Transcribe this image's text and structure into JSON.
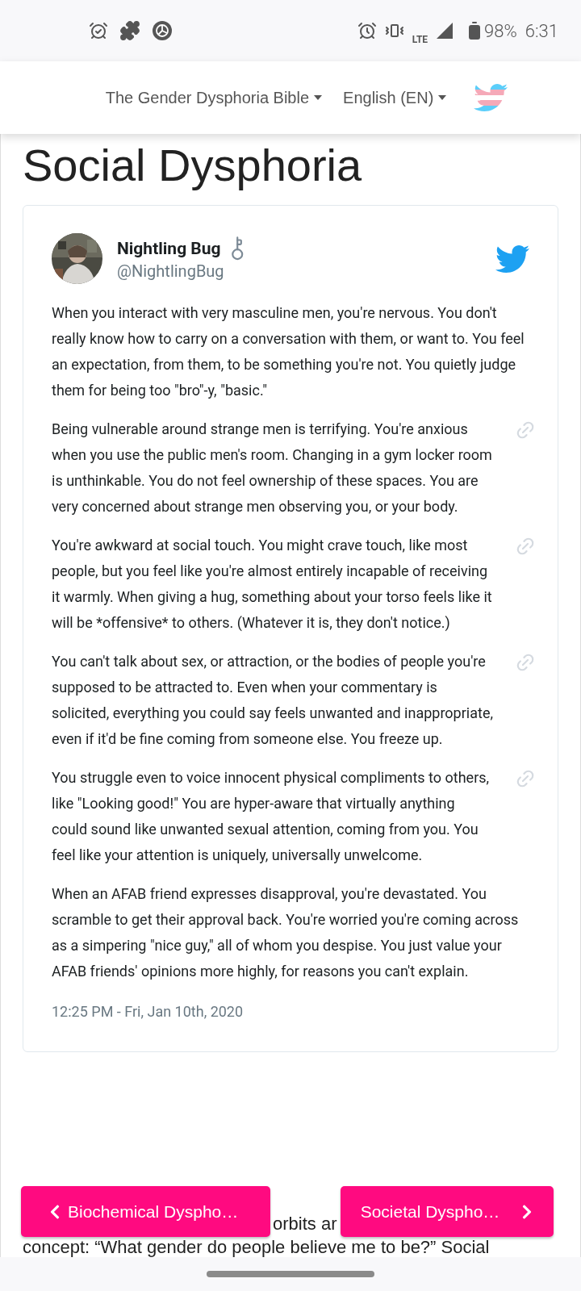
{
  "status_bar": {
    "battery": "98%",
    "time": "6:31",
    "network": "LTE"
  },
  "nav": {
    "items": [
      {
        "label": "The Gender Dysphoria Bible"
      },
      {
        "label": "English (EN)"
      }
    ]
  },
  "page_title": "Social Dysphoria",
  "tweet": {
    "name": "Nightling Bug",
    "handle": "@NightlingBug",
    "paragraphs": [
      {
        "text": "When you interact with very masculine men, you're nervous. You don't really know how to carry on a conversation with them, or want to. You feel an expectation, from them, to be something you're not. You quietly judge them for being too \"bro\"-y, \"basic.\"",
        "linked": false
      },
      {
        "text": "Being vulnerable around strange men is terrifying. You're anxious when you use the public men's room. Changing in a gym locker room is unthinkable. You do not feel ownership of these spaces. You are very concerned about strange men observing you, or your body.",
        "linked": true
      },
      {
        "text": "You're awkward at social touch. You might crave touch, like most people, but you feel like you're almost entirely incapable of receiving it warmly. When giving a hug, something about your torso feels like it will be *offensive* to others. (Whatever it is, they don't notice.)",
        "linked": true
      },
      {
        "text": "You can't talk about sex, or attraction, or the bodies of people you're supposed to be attracted to. Even when your commentary is solicited, everything you could say feels unwanted and inappropriate, even if it'd be fine coming from someone else. You freeze up.",
        "linked": true
      },
      {
        "text": "You struggle even to voice innocent physical compliments to others, like \"Looking good!\" You are hyper-aware that virtually anything could sound like unwanted sexual attention, coming from you. You feel like your attention is uniquely, universally unwelcome.",
        "linked": true
      },
      {
        "text": "When an AFAB friend expresses disapproval, you're devastated. You scramble to get their approval back. You're worried you're coming across as a simpering \"nice guy,\" all of whom you despise. You just value your AFAB friends' opinions more highly, for reasons you can't explain.",
        "linked": false
      }
    ],
    "timestamp": "12:25 PM - Fri, Jan 10th, 2020"
  },
  "body_text": {
    "line_1": "orbits ar",
    "line_2": "concept: “What gender do people believe me to be?” Social"
  },
  "buttons": {
    "previous": "Biochemical Dyspho…",
    "next": "Societal Dyspho…"
  }
}
